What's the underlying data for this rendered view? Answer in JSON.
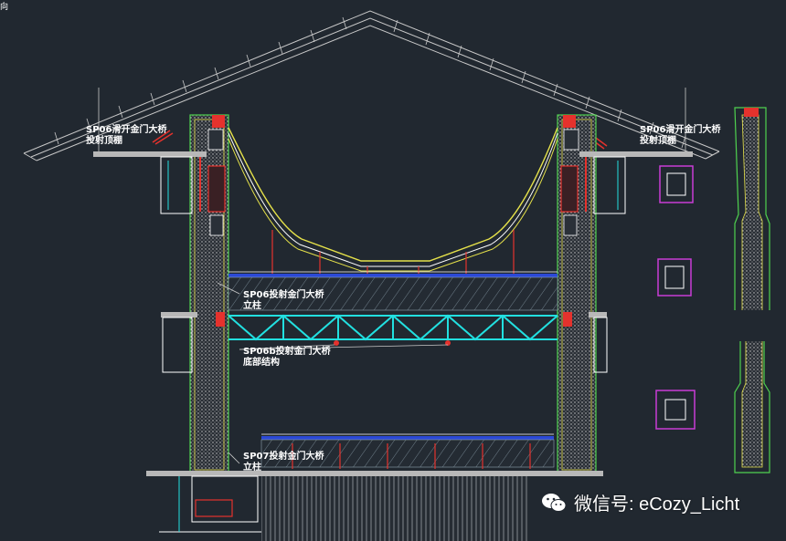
{
  "corner_mark": "向",
  "labels": {
    "top_left": [
      "SP06滑开金门大桥",
      "投射顶棚"
    ],
    "top_right": [
      "SP06滑开金门大桥",
      "投射顶棚"
    ],
    "upper_column": [
      "SP06投射金门大桥",
      "立柱"
    ],
    "bottom_structure": [
      "SP06b投射金门大桥",
      "底部结构"
    ],
    "lower_column": [
      "SP07投射金门大桥",
      "立柱"
    ]
  },
  "watermark": {
    "text": "微信号: eCozy_Licht",
    "icon": "wechat-icon"
  },
  "colors": {
    "background": "#212830",
    "roof": "#c8c8c8",
    "column_outline": "#4fd24f",
    "column_fill_dots": "#d8d8d8",
    "red": "#e5322d",
    "cyan": "#22e0e0",
    "yellow": "#e6e24a",
    "blue": "#2b49d6",
    "magenta": "#c93cd6",
    "white": "#ffffff"
  }
}
